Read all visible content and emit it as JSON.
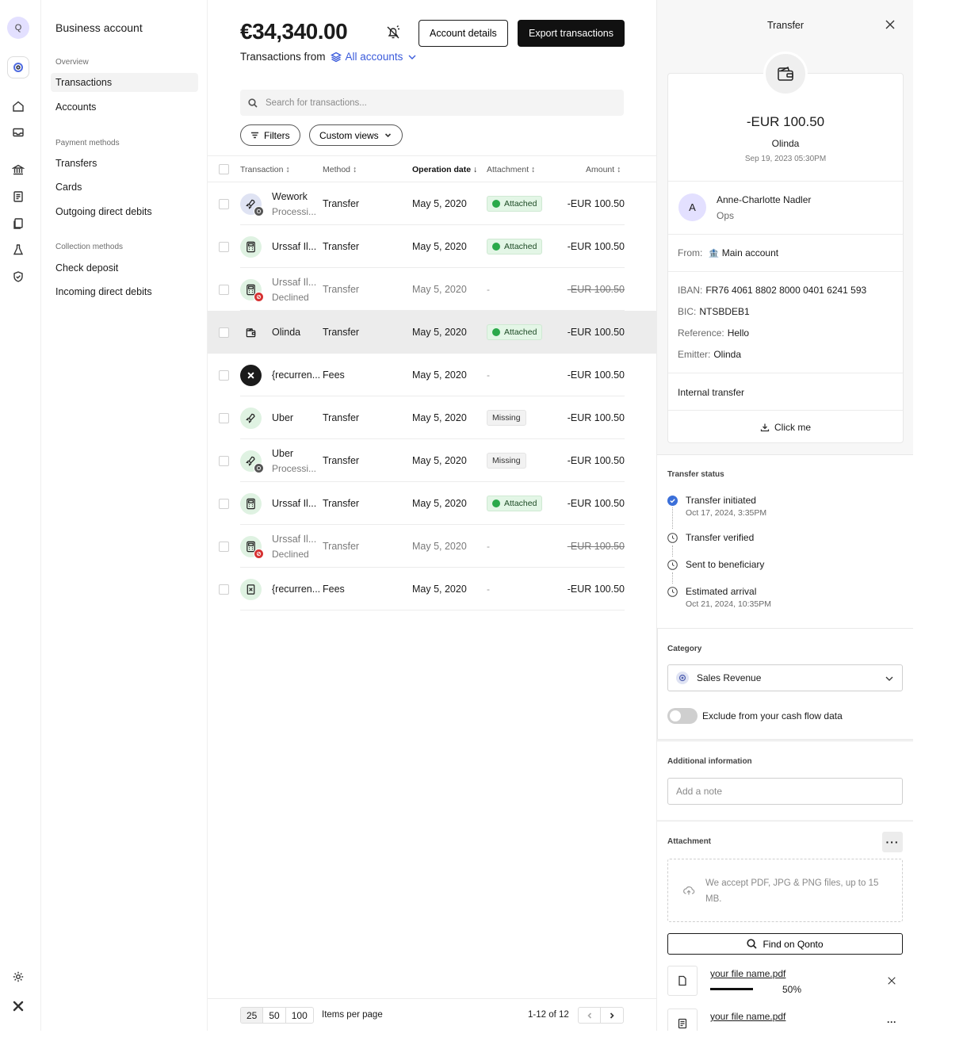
{
  "sidebar": {
    "org_initial": "Q",
    "title": "Business account",
    "sections": [
      {
        "label": "Overview",
        "items": [
          "Transactions",
          "Accounts"
        ]
      },
      {
        "label": "Payment methods",
        "items": [
          "Transfers",
          "Cards",
          "Outgoing direct debits"
        ]
      },
      {
        "label": "Collection methods",
        "items": [
          "Check deposit",
          "Incoming direct debits"
        ]
      }
    ],
    "active_item": "Transactions"
  },
  "header": {
    "balance": "€34,340.00",
    "account_details": "Account details",
    "export": "Export transactions",
    "from_label": "Transactions from",
    "accounts_selector": "All accounts"
  },
  "search": {
    "placeholder": "Search for transactions..."
  },
  "filters": {
    "filters_label": "Filters",
    "views_label": "Custom views"
  },
  "table": {
    "columns": [
      "Transaction",
      "Method",
      "Operation date",
      "Attachment",
      "Amount"
    ],
    "sort_active_column": "Operation date",
    "rows": [
      {
        "name": "Wework",
        "sub": "Processi...",
        "method": "Transfer",
        "date": "May 5, 2020",
        "attachment": "Attached",
        "amount": "-EUR 100.50",
        "icon": "rocket-icon",
        "badge": "processing"
      },
      {
        "name": "Urssaf Il...",
        "sub": "",
        "method": "Transfer",
        "date": "May 5, 2020",
        "attachment": "Attached",
        "amount": "-EUR 100.50",
        "icon": "calculator-icon",
        "badge": ""
      },
      {
        "name": "Urssaf Il...",
        "sub": "Declined",
        "method": "Transfer",
        "date": "May 5, 2020",
        "attachment": "-",
        "amount": "-EUR 100.50",
        "icon": "calculator-icon",
        "badge": "declined"
      },
      {
        "name": "Olinda",
        "sub": "",
        "method": "Transfer",
        "date": "May 5, 2020",
        "attachment": "Attached",
        "amount": "-EUR 100.50",
        "icon": "wallet-icon",
        "badge": ""
      },
      {
        "name": "{recurren...",
        "sub": "",
        "method": "Fees",
        "date": "May 5, 2020",
        "attachment": "-",
        "amount": "-EUR 100.50",
        "icon": "qonto-icon",
        "badge": ""
      },
      {
        "name": "Uber",
        "sub": "",
        "method": "Transfer",
        "date": "May 5, 2020",
        "attachment": "Missing",
        "amount": "-EUR 100.50",
        "icon": "rocket-icon",
        "badge": ""
      },
      {
        "name": "Uber",
        "sub": "Processi...",
        "method": "Transfer",
        "date": "May 5, 2020",
        "attachment": "Missing",
        "amount": "-EUR 100.50",
        "icon": "rocket-icon",
        "badge": "processing"
      },
      {
        "name": "Urssaf Il...",
        "sub": "",
        "method": "Transfer",
        "date": "May 5, 2020",
        "attachment": "Attached",
        "amount": "-EUR 100.50",
        "icon": "calculator-icon",
        "badge": ""
      },
      {
        "name": "Urssaf Il...",
        "sub": "Declined",
        "method": "Transfer",
        "date": "May 5, 2020",
        "attachment": "-",
        "amount": "-EUR 100.50",
        "icon": "calculator-icon",
        "badge": "declined"
      },
      {
        "name": "{recurren...",
        "sub": "",
        "method": "Fees",
        "date": "May 5, 2020",
        "attachment": "-",
        "amount": "-EUR 100.50",
        "icon": "invoice-icon",
        "badge": ""
      }
    ]
  },
  "pagination": {
    "sizes": [
      "25",
      "50",
      "100"
    ],
    "selected_size": "25",
    "items_per_page": "Items per page",
    "range": "1-12 of 12"
  },
  "panel": {
    "title": "Transfer",
    "amount": "-EUR 100.50",
    "counterparty": "Olinda",
    "timestamp": "Sep 19, 2023 05:30PM",
    "user": {
      "initial": "A",
      "name": "Anne-Charlotte Nadler",
      "team": "Ops"
    },
    "from": {
      "label": "From:",
      "value": "Main account"
    },
    "details": [
      {
        "label": "IBAN:",
        "value": "FR76 4061 8802 8000 0401 6241 593"
      },
      {
        "label": "BIC:",
        "value": "NTSBDEB1"
      },
      {
        "label": "Reference:",
        "value": "Hello"
      },
      {
        "label": "Emitter:",
        "value": "Olinda"
      }
    ],
    "internal_transfer": "Internal transfer",
    "click_me": "Click me",
    "status_title": "Transfer status",
    "steps": [
      {
        "label": "Transfer initiated",
        "date": "Oct 17, 2024, 3:35PM",
        "done": true
      },
      {
        "label": "Transfer verified",
        "date": "",
        "done": false
      },
      {
        "label": "Sent to beneficiary",
        "date": "",
        "done": false
      },
      {
        "label": "Estimated arrival",
        "date": "Oct 21, 2024, 10:35PM",
        "done": false
      }
    ],
    "category_title": "Category",
    "category_value": "Sales Revenue",
    "exclude_label": "Exclude from your cash flow data",
    "exclude_on": false,
    "additional_title": "Additional information",
    "note_placeholder": "Add a note",
    "attachment_title": "Attachment",
    "upload_hint": "We accept PDF, JPG & PNG files, up to 15 MB.",
    "find_button": "Find on Qonto",
    "files": [
      {
        "name": "your file name.pdf",
        "progress_label": "50%",
        "progress": 0.5
      },
      {
        "name": "your file name.pdf",
        "progress_label": "",
        "progress": null
      }
    ]
  },
  "colors": {
    "accent": "#3b5bdb",
    "success": "#2aa94a",
    "error": "#d63131",
    "primary_button": "#111111",
    "highlight_row": "#ececec"
  }
}
